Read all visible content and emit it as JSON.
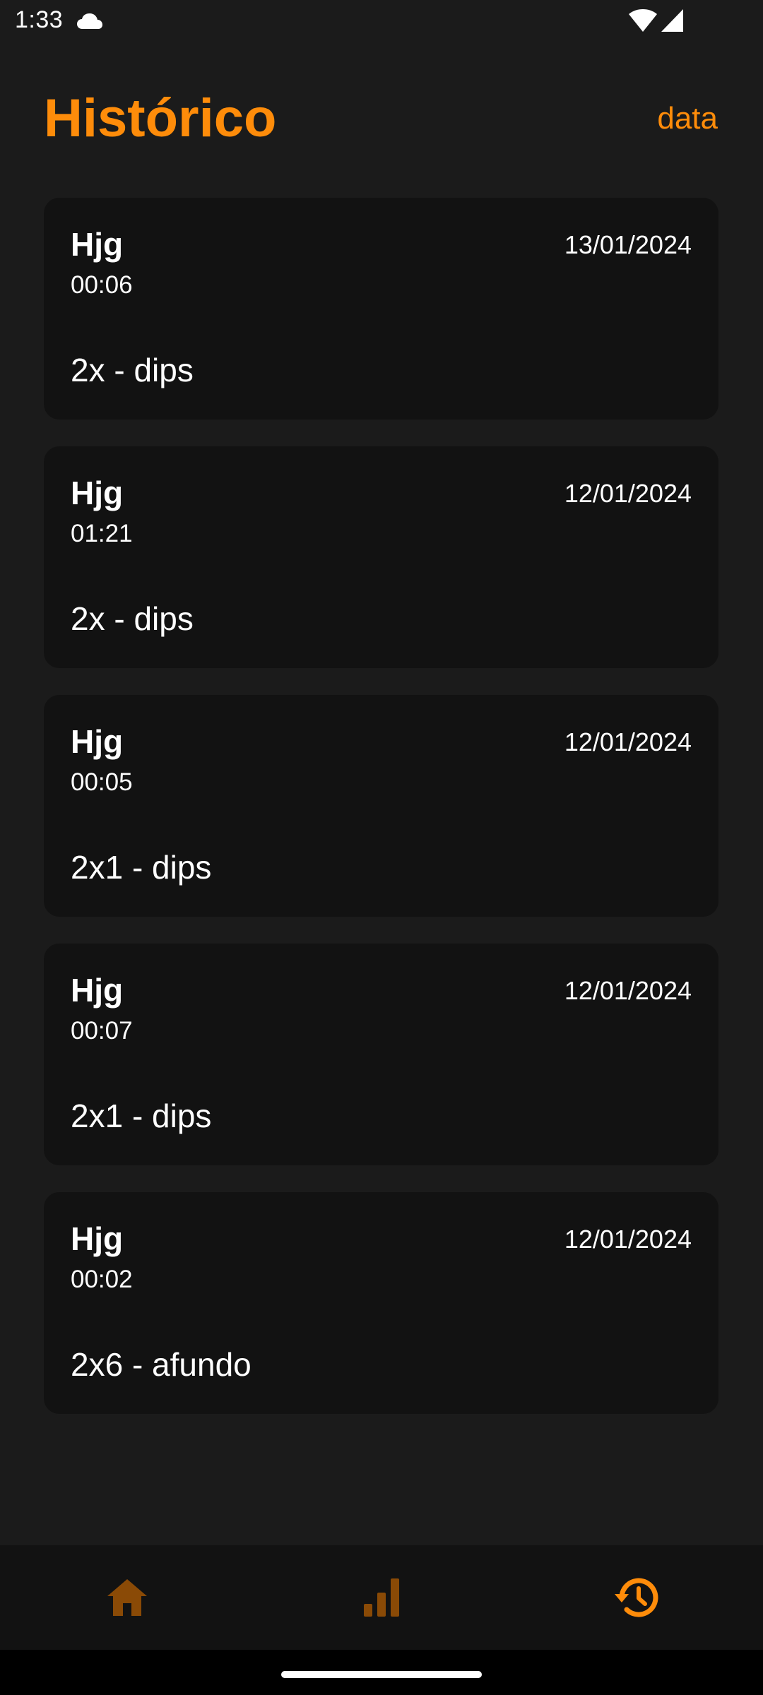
{
  "status_bar": {
    "time": "1:33",
    "icons": [
      "cloud-icon",
      "wifi-icon",
      "signal-icon"
    ]
  },
  "header": {
    "title": "Histórico",
    "sort_label": "data"
  },
  "history": [
    {
      "workout": "Hjg",
      "date": "13/01/2024",
      "duration": "00:06",
      "exercise": "2x - dips"
    },
    {
      "workout": "Hjg",
      "date": "12/01/2024",
      "duration": "01:21",
      "exercise": "2x - dips"
    },
    {
      "workout": "Hjg",
      "date": "12/01/2024",
      "duration": "00:05",
      "exercise": "2x1 - dips"
    },
    {
      "workout": "Hjg",
      "date": "12/01/2024",
      "duration": "00:07",
      "exercise": "2x1 - dips"
    },
    {
      "workout": "Hjg",
      "date": "12/01/2024",
      "duration": "00:02",
      "exercise": "2x6 - afundo"
    }
  ],
  "bottom_nav": {
    "items": [
      {
        "icon": "home-icon",
        "active": false
      },
      {
        "icon": "bar-chart-icon",
        "active": false
      },
      {
        "icon": "history-icon",
        "active": true
      }
    ]
  },
  "colors": {
    "accent": "#fe8c0a",
    "accent_dim": "#8a4a06",
    "background": "#1b1b1b",
    "card": "#121212",
    "text": "#ffffff"
  }
}
